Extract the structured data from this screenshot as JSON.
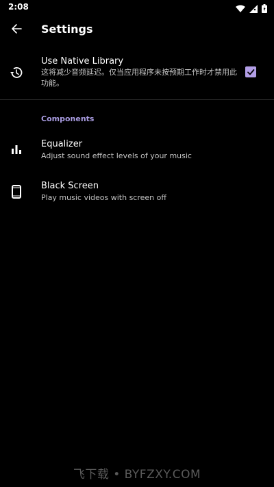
{
  "status_bar": {
    "time": "2:08",
    "icons": [
      "wifi-icon",
      "signal-icon",
      "battery-icon"
    ]
  },
  "app_bar": {
    "title": "Settings",
    "back_icon": "arrow-back-icon"
  },
  "preferences": {
    "native_library": {
      "icon": "history-icon",
      "title": "Use Native Library",
      "summary": "这将减少音频延迟。仅当应用程序未按预期工作时才禁用此功能。",
      "checked": true
    },
    "category": "Components",
    "equalizer": {
      "icon": "equalizer-icon",
      "title": "Equalizer",
      "summary": "Adjust sound effect levels of your music"
    },
    "black_screen": {
      "icon": "phone-icon",
      "title": "Black Screen",
      "summary": "Play music videos with screen off"
    }
  },
  "watermark": "飞下载 • BYFZXY.COM",
  "colors": {
    "background": "#000000",
    "accent": "#b29ee6",
    "category": "#a89be0",
    "summary": "#c4c4c4"
  }
}
